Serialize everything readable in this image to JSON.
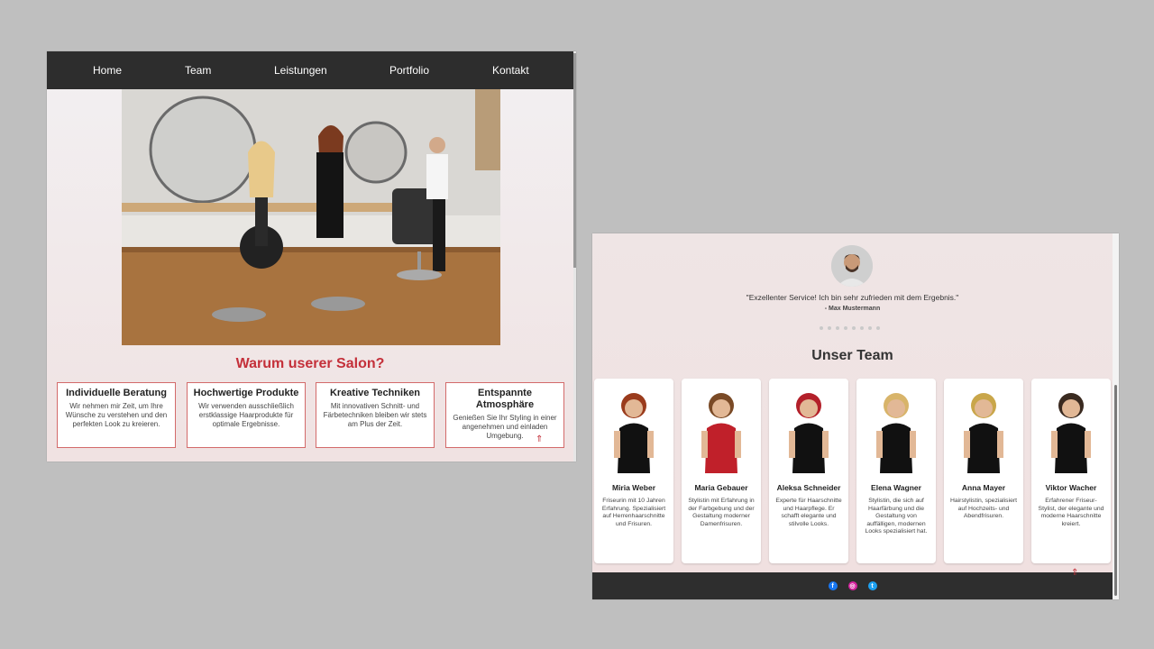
{
  "left": {
    "nav": [
      "Home",
      "Team",
      "Leistungen",
      "Portfolio",
      "Kontakt"
    ],
    "section_title": "Warum userer Salon?",
    "features": [
      {
        "title": "Individuelle Beratung",
        "text": "Wir nehmen mir Zeit, um Ihre Wünsche zu verstehen und den perfekten Look zu kreieren."
      },
      {
        "title": "Hochwertige Produkte",
        "text": "Wir verwenden ausschließlich erstklassige Haarprodukte für optimale Ergebnisse."
      },
      {
        "title": "Kreative Techniken",
        "text": "Mit innovativen Schnitt- und Färbetechniken bleiben wir stets am Plus der Zeit."
      },
      {
        "title": "Entspannte Atmosphäre",
        "text": "Genießen Sie Ihr Styling in einer angenehmen und einladen Umgebung."
      }
    ]
  },
  "right": {
    "quote": "\"Exzellenter Service! Ich bin sehr zufrieden mit dem Ergebnis.\"",
    "author": "- Max Mustermann",
    "team_title": "Unser Team",
    "team": [
      {
        "name": "Miria Weber",
        "desc": "Friseurin mit 10 Jahren Erfahrung. Spezialisiert auf Herrenhaarschnitte und Frisuren.",
        "hair": "#9a3b1c",
        "outfit": "#111111"
      },
      {
        "name": "Maria Gebauer",
        "desc": "Stylistin mit Erfahrung in der Farbgebung und der Gestaltung moderner Damenfrisuren.",
        "hair": "#7a4a26",
        "outfit": "#c0202a"
      },
      {
        "name": "Aleksa Schneider",
        "desc": "Experte für Haarschnitte und Haarpflege. Er schafft elegante und stilvolle Looks.",
        "hair": "#b3202a",
        "outfit": "#111111"
      },
      {
        "name": "Elena Wagner",
        "desc": "Stylistin, die sich auf Haarfärbung und die Gestaltung von auffälligen, modernen Looks spezialisiert hat.",
        "hair": "#d8b46a",
        "outfit": "#111111"
      },
      {
        "name": "Anna Mayer",
        "desc": "Hairstylistin, spezialisiert auf Hochzeits- und Abendfrisuren.",
        "hair": "#c9a64a",
        "outfit": "#111111"
      },
      {
        "name": "Viktor Wacher",
        "desc": "Erfahrener Friseur-Stylist, der elegante und moderne Haarschnitte kreiert.",
        "hair": "#3a2a20",
        "outfit": "#111111"
      }
    ],
    "social": [
      {
        "name": "facebook-icon",
        "glyph": "f",
        "color": "#1877f2"
      },
      {
        "name": "instagram-icon",
        "glyph": "◎",
        "color": "#d6249f"
      },
      {
        "name": "twitter-icon",
        "glyph": "t",
        "color": "#1da1f2"
      }
    ]
  }
}
